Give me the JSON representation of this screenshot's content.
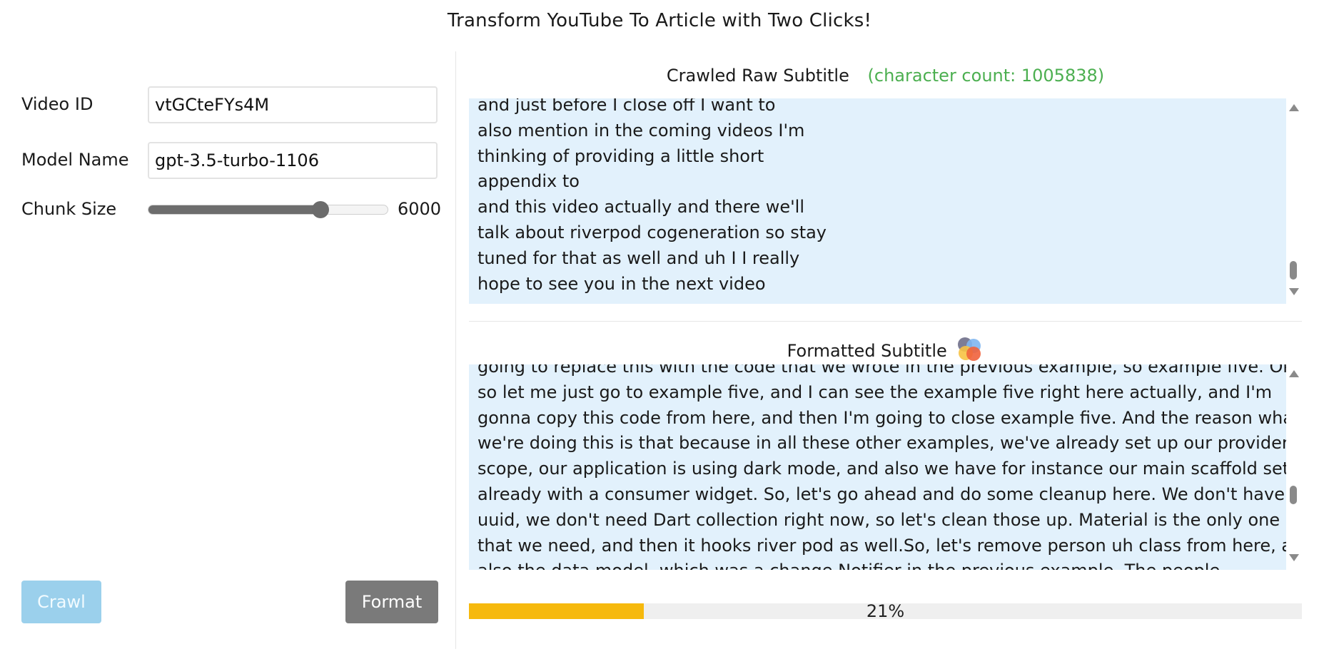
{
  "app": {
    "title": "Transform YouTube To Article with Two Clicks!"
  },
  "form": {
    "video_id_label": "Video ID",
    "video_id_value": "vtGCteFYs4M",
    "model_name_label": "Model Name",
    "model_name_value": "gpt-3.5-turbo-1106",
    "chunk_size_label": "Chunk Size",
    "chunk_size_value": "6000",
    "chunk_size_level": 0.72
  },
  "buttons": {
    "crawl_label": "Crawl",
    "format_label": "Format"
  },
  "raw_panel": {
    "title": "Crawled Raw Subtitle",
    "char_count": "(character count: 1005838)",
    "lines": [
      "and just before I close off I want to",
      "also mention in the coming videos I'm",
      "thinking of providing a little short",
      "appendix to",
      "and this video actually and there we'll",
      "talk about riverpod cogeneration so stay",
      "tuned for that as well and uh I I really",
      "hope to see you in the next video"
    ]
  },
  "formatted_panel": {
    "title": "Formatted Subtitle",
    "lines": [
      "going to replace this with the code that we wrote in the previous example, so example five. Okay,",
      "so let me just go to example five, and I can see the example five right here actually, and I'm",
      "gonna copy this code from here, and then I'm going to close example five. And the reason what",
      "we're doing this is that because in all these other examples, we've already set up our provider",
      "scope, our application is using dark mode, and also we have for instance our main scaffold set up",
      "already with a consumer widget. So, let's go ahead and do some cleanup here. We don't have",
      "uuid, we don't need Dart collection right now, so let's clean those up. Material is the only one",
      "that we need, and then it hooks river pod as well.So, let's remove person uh class from here, and",
      "also the data model, which was a change Notifier in the previous example. The people"
    ]
  },
  "progress": {
    "percent": 21,
    "label": "21%"
  },
  "colors": {
    "accent_green": "#4caf50",
    "text_box_bg": "#e2f1fc",
    "progress_fill": "#f6b90d",
    "crawl_button": "#9bd0ec",
    "format_button": "#7a7a7a"
  }
}
